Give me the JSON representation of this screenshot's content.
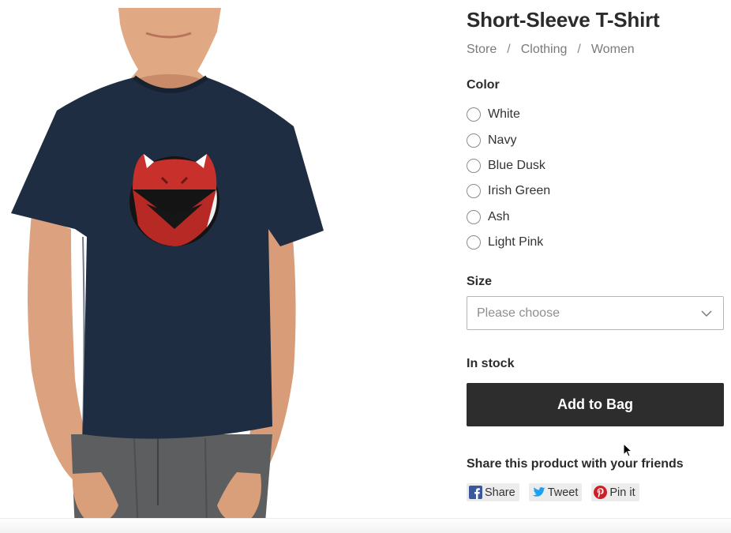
{
  "product": {
    "title": "Short-Sleeve T-Shirt",
    "image_alt": "Model wearing navy t-shirt with red fox logo"
  },
  "breadcrumb": [
    "Store",
    "Clothing",
    "Women"
  ],
  "breadcrumb_separator": "/",
  "color": {
    "label": "Color",
    "options": [
      "White",
      "Navy",
      "Blue Dusk",
      "Irish Green",
      "Ash",
      "Light Pink"
    ]
  },
  "size": {
    "label": "Size",
    "placeholder": "Please choose"
  },
  "stock": {
    "status": "In stock"
  },
  "cart": {
    "add_label": "Add to Bag"
  },
  "share": {
    "heading": "Share this product with your friends",
    "buttons": [
      {
        "label": "Share",
        "icon": "facebook-icon",
        "color": "#3b5998"
      },
      {
        "label": "Tweet",
        "icon": "twitter-icon",
        "color": "#1da1f2"
      },
      {
        "label": "Pin it",
        "icon": "pinterest-icon",
        "color": "#cb2027"
      }
    ]
  },
  "colors": {
    "button_bg": "#2d2d2d",
    "shirt": "#1e2d42",
    "logo_red": "#c8302b"
  }
}
